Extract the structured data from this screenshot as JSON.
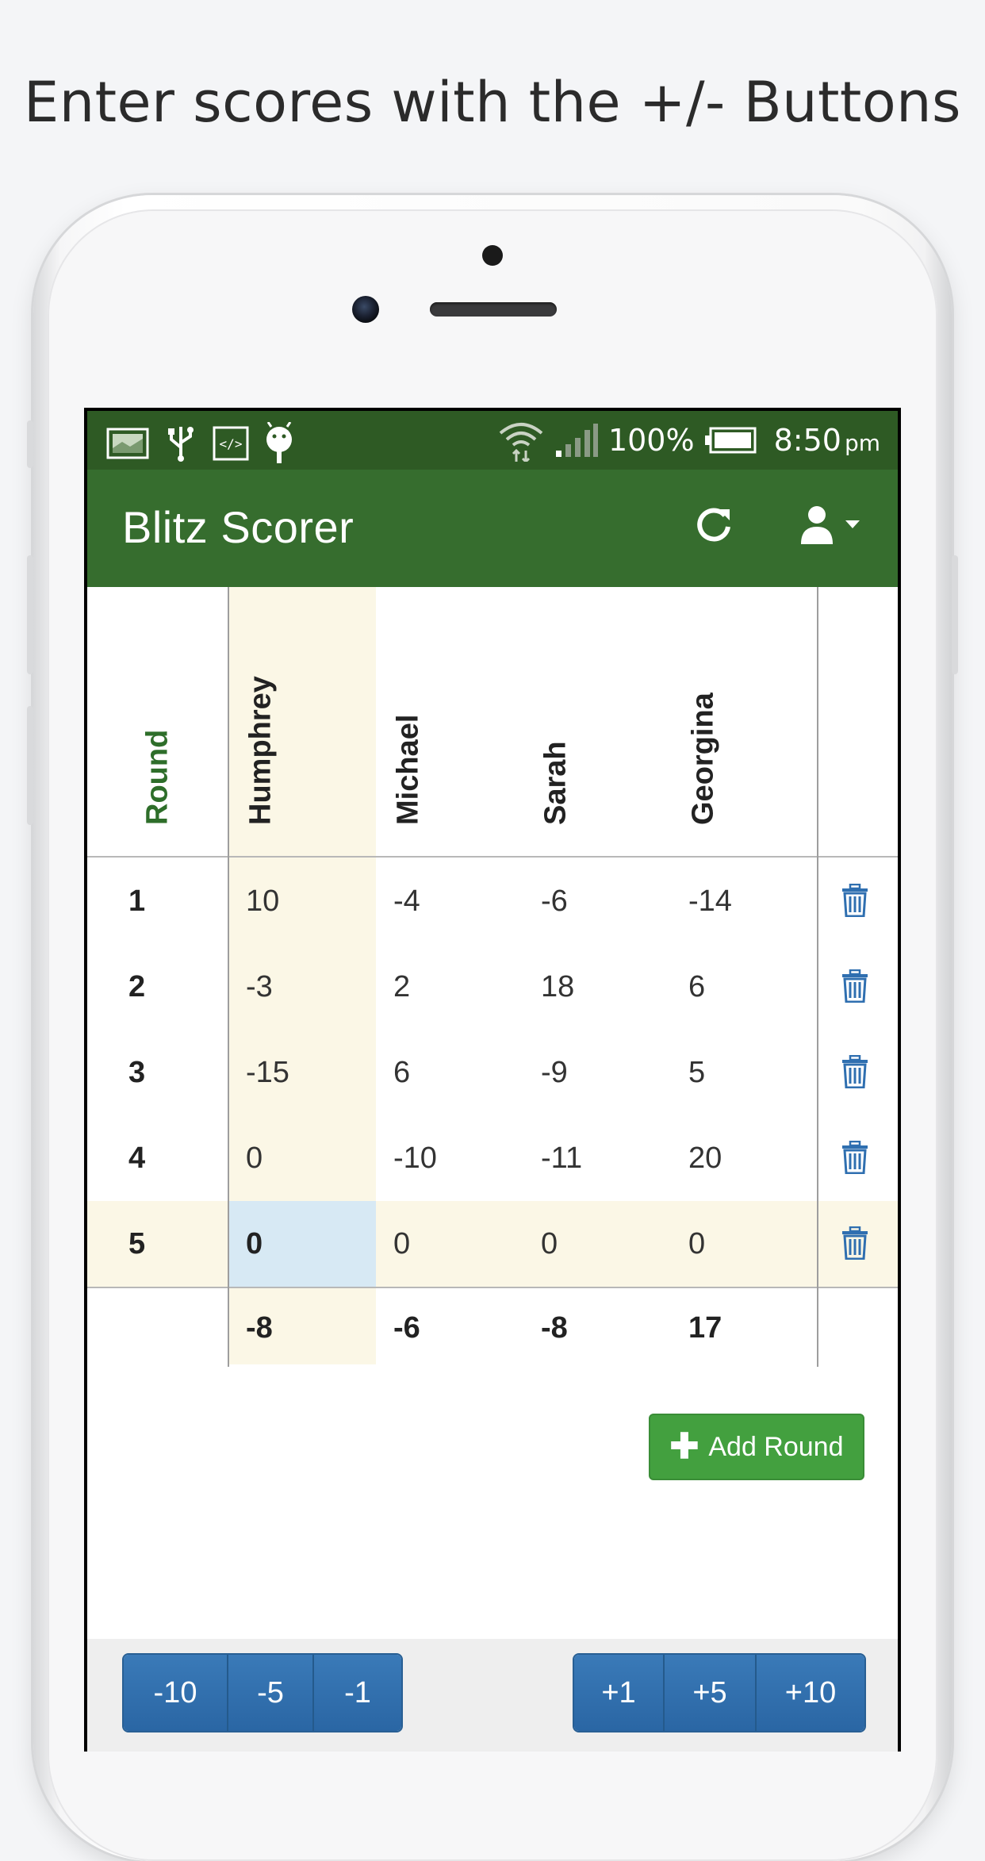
{
  "caption": "Enter scores with the +/- Buttons",
  "status_bar": {
    "battery": "100%",
    "time": "8:50",
    "ampm": "pm",
    "icons": [
      "image-icon",
      "usb-icon",
      "code-icon",
      "android-icon",
      "wifi-icon",
      "signal-icon",
      "battery-icon"
    ]
  },
  "app": {
    "title": "Blitz Scorer",
    "refresh_icon": "refresh-icon",
    "user_icon": "user-dropdown-icon"
  },
  "table": {
    "round_header": "Round",
    "players": [
      "Humphrey",
      "Michael",
      "Sarah",
      "Georgina"
    ],
    "rows": [
      {
        "round": "1",
        "scores": [
          "10",
          "-4",
          "-6",
          "-14"
        ]
      },
      {
        "round": "2",
        "scores": [
          "-3",
          "2",
          "18",
          "6"
        ]
      },
      {
        "round": "3",
        "scores": [
          "-15",
          "6",
          "-9",
          "5"
        ]
      },
      {
        "round": "4",
        "scores": [
          "0",
          "-10",
          "-11",
          "20"
        ]
      },
      {
        "round": "5",
        "scores": [
          "0",
          "0",
          "0",
          "0"
        ]
      }
    ],
    "totals": [
      "-8",
      "-6",
      "-8",
      "17"
    ],
    "current_round": "5",
    "selected_player": "Humphrey"
  },
  "add_round_label": "Add Round",
  "minus_buttons": [
    "-10",
    "-5",
    "-1"
  ],
  "plus_buttons": [
    "+1",
    "+5",
    "+10"
  ],
  "colors": {
    "status_bar": "#2e5a24",
    "app_bar": "#366d2e",
    "round_header": "#2e6e2a",
    "highlight": "#fbf7e6",
    "selected_cell": "#d7e9f4",
    "add_button": "#43a03f",
    "score_buttons": "#2a66a4",
    "trash": "#2f6fb0"
  }
}
